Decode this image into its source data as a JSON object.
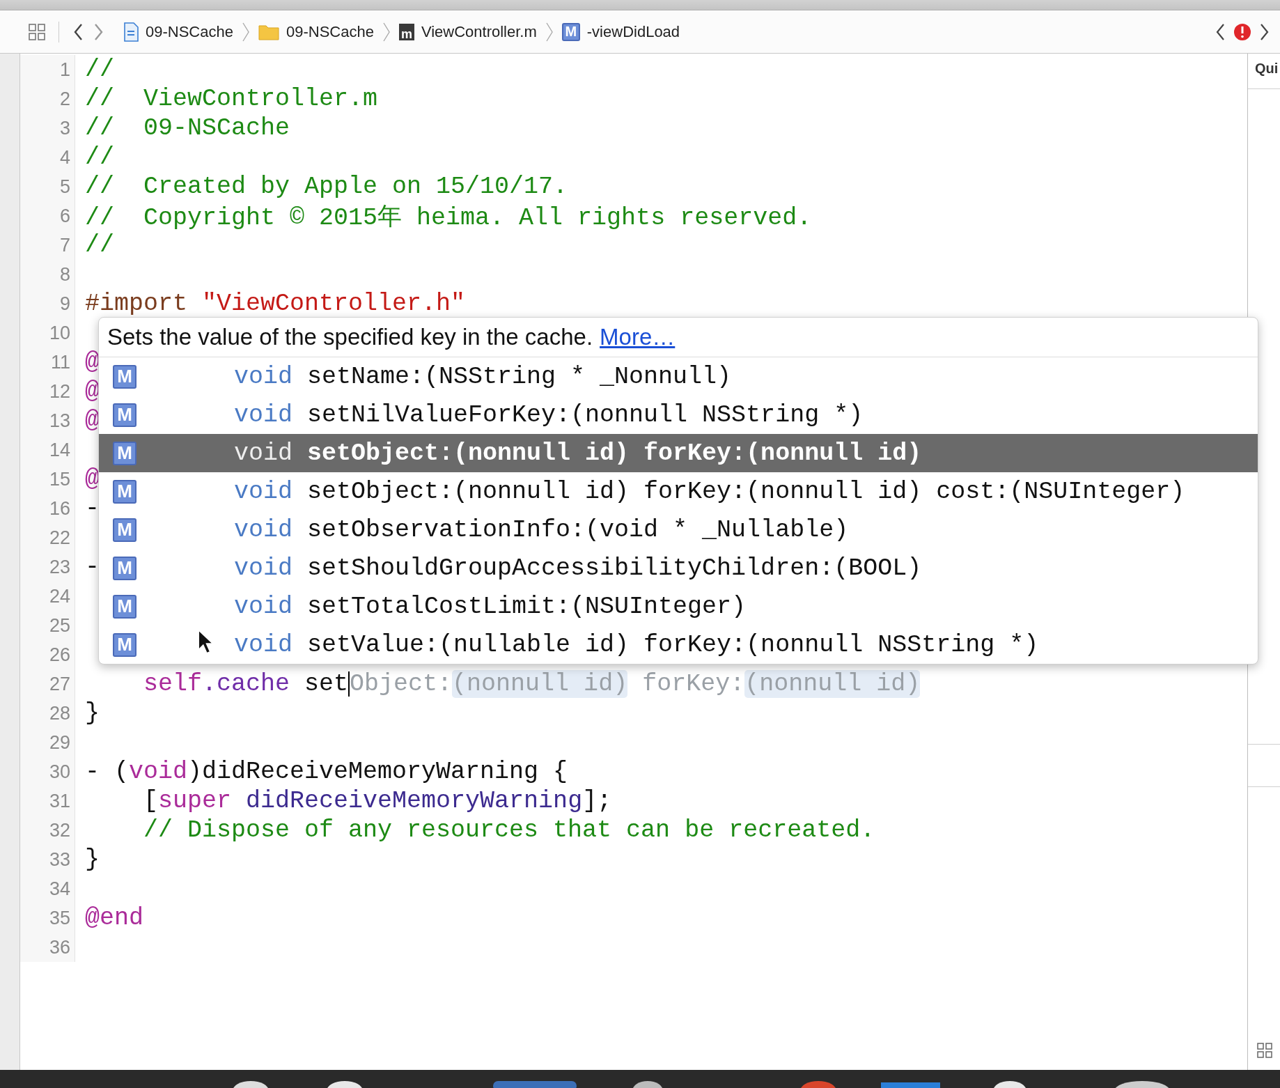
{
  "toolbar": {
    "breadcrumbs": [
      {
        "kind": "project",
        "label": "09-NSCache"
      },
      {
        "kind": "folder",
        "label": "09-NSCache"
      },
      {
        "kind": "file",
        "icon_letter": "m",
        "label": "ViewController.m"
      },
      {
        "kind": "method",
        "icon_letter": "M",
        "label": "-viewDidLoad"
      }
    ],
    "has_error": true
  },
  "editor": {
    "lines": [
      {
        "number": "1",
        "segments": [
          {
            "kind": "comment",
            "text": "//"
          }
        ]
      },
      {
        "number": "2",
        "segments": [
          {
            "kind": "comment",
            "text": "//  ViewController.m"
          }
        ]
      },
      {
        "number": "3",
        "segments": [
          {
            "kind": "comment",
            "text": "//  09-NSCache"
          }
        ]
      },
      {
        "number": "4",
        "segments": [
          {
            "kind": "comment",
            "text": "//"
          }
        ]
      },
      {
        "number": "5",
        "segments": [
          {
            "kind": "comment",
            "text": "//  Created by Apple on 15/10/17."
          }
        ]
      },
      {
        "number": "6",
        "segments": [
          {
            "kind": "comment",
            "text": "//  Copyright © 2015年 heima. All rights reserved."
          }
        ]
      },
      {
        "number": "7",
        "segments": [
          {
            "kind": "comment",
            "text": "//"
          }
        ]
      },
      {
        "number": "8"
      },
      {
        "number": "9",
        "segments": [
          {
            "kind": "directive",
            "text": "#import "
          },
          {
            "kind": "string",
            "text": "\"ViewController.h\""
          }
        ]
      },
      {
        "number": "10"
      },
      {
        "number": "11",
        "segments": [
          {
            "kind": "keyword",
            "text": "@"
          }
        ]
      },
      {
        "number": "12",
        "segments": [
          {
            "kind": "keyword",
            "text": "@"
          }
        ]
      },
      {
        "number": "13",
        "segments": [
          {
            "kind": "keyword",
            "text": "@"
          }
        ]
      },
      {
        "number": "14"
      },
      {
        "number": "15",
        "segments": [
          {
            "kind": "keyword",
            "text": "@"
          }
        ]
      },
      {
        "number": "16",
        "segments": [
          {
            "kind": "plain",
            "text": "-"
          }
        ]
      },
      {
        "number": "22"
      },
      {
        "number": "23",
        "segments": [
          {
            "kind": "plain",
            "text": "-"
          }
        ]
      },
      {
        "number": "24"
      },
      {
        "number": "25"
      },
      {
        "number": "26"
      },
      {
        "number": "27",
        "indent": true,
        "segments": [
          {
            "kind": "keyword",
            "text": "self"
          },
          {
            "kind": "property",
            "text": ".cache"
          },
          {
            "kind": "plain",
            "text": " set",
            "caret": true
          },
          {
            "kind": "ghost",
            "text": "Object:"
          },
          {
            "kind": "token",
            "text": "(nonnull id)"
          },
          {
            "kind": "ghost",
            "text": " forKey:"
          },
          {
            "kind": "token",
            "text": "(nonnull id)"
          }
        ]
      },
      {
        "number": "28",
        "segments": [
          {
            "kind": "plain",
            "text": "}"
          }
        ]
      },
      {
        "number": "29"
      },
      {
        "number": "30",
        "segments": [
          {
            "kind": "plain",
            "text": "- ("
          },
          {
            "kind": "keyword",
            "text": "void"
          },
          {
            "kind": "plain",
            "text": ")didReceiveMemoryWarning {"
          }
        ]
      },
      {
        "number": "31",
        "indent": true,
        "segments": [
          {
            "kind": "plain",
            "text": "["
          },
          {
            "kind": "keyword",
            "text": "super"
          },
          {
            "kind": "method",
            "text": " didReceiveMemoryWarning"
          },
          {
            "kind": "plain",
            "text": "];"
          }
        ]
      },
      {
        "number": "32",
        "indent": true,
        "segments": [
          {
            "kind": "comment",
            "text": "// Dispose of any resources that can be recreated."
          }
        ]
      },
      {
        "number": "33",
        "segments": [
          {
            "kind": "plain",
            "text": "}"
          }
        ]
      },
      {
        "number": "34"
      },
      {
        "number": "35",
        "segments": [
          {
            "kind": "keyword",
            "text": "@end"
          }
        ]
      },
      {
        "number": "36"
      }
    ]
  },
  "completion": {
    "summary": "Sets the value of the specified key in the cache.",
    "more_link": "More…",
    "items": [
      {
        "badge": "M",
        "return_type": "void",
        "signature": "setName:(NSString * _Nonnull)",
        "selected": false
      },
      {
        "badge": "M",
        "return_type": "void",
        "signature": "setNilValueForKey:(nonnull NSString *)",
        "selected": false
      },
      {
        "badge": "M",
        "return_type": "void",
        "signature": "setObject:(nonnull id) forKey:(nonnull id)",
        "selected": true
      },
      {
        "badge": "M",
        "return_type": "void",
        "signature": "setObject:(nonnull id) forKey:(nonnull id) cost:(NSUInteger)",
        "selected": false
      },
      {
        "badge": "M",
        "return_type": "void",
        "signature": "setObservationInfo:(void * _Nullable)",
        "selected": false
      },
      {
        "badge": "M",
        "return_type": "void",
        "signature": "setShouldGroupAccessibilityChildren:(BOOL)",
        "selected": false
      },
      {
        "badge": "M",
        "return_type": "void",
        "signature": "setTotalCostLimit:(NSUInteger)",
        "selected": false
      },
      {
        "badge": "M",
        "return_type": "void",
        "signature": "setValue:(nullable id) forKey:(nonnull NSString *)",
        "selected": false
      }
    ]
  },
  "inspector": {
    "title": "Qui"
  }
}
